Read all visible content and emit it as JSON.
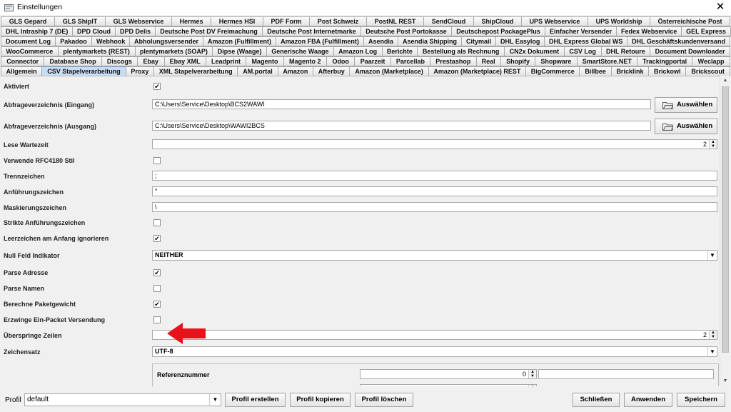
{
  "window": {
    "title": "Einstellungen",
    "close_glyph": "✕"
  },
  "tab_rows": [
    [
      "GLS Gepard",
      "GLS ShipIT",
      "GLS Webservice",
      "Hermes",
      "Hermes HSI",
      "PDF Form",
      "Post Schweiz",
      "PostNL REST",
      "SendCloud",
      "ShipCloud",
      "UPS Webservice",
      "UPS Worldship",
      "Österreichische Post"
    ],
    [
      "DHL Intraship 7 (DE)",
      "DPD Cloud",
      "DPD Delis",
      "Deutsche Post DV Freimachung",
      "Deutsche Post Internetmarke",
      "Deutsche Post Portokasse",
      "Deutschepost PackagePlus",
      "Einfacher Versender",
      "Fedex Webservice",
      "GEL Express"
    ],
    [
      "Document Log",
      "Pakadoo",
      "Webhook",
      "Abholungsversender",
      "Amazon (Fulfillment)",
      "Amazon FBA (Fulfillment)",
      "Asendia",
      "Asendia Shipping",
      "Citymail",
      "DHL Easylog",
      "DHL Express Global WS",
      "DHL Geschäftskundenversand"
    ],
    [
      "WooCommerce",
      "plentymarkets (REST)",
      "plentymarkets (SOAP)",
      "Dipse (Waage)",
      "Generische Waage",
      "Amazon Log",
      "Berichte",
      "Bestellung als Rechnung",
      "CN2x Dokument",
      "CSV Log",
      "DHL Retoure",
      "Document Downloader"
    ],
    [
      "Connector",
      "Database Shop",
      "Discogs",
      "Ebay",
      "Ebay XML",
      "Leadprint",
      "Magento",
      "Magento 2",
      "Odoo",
      "Paarzeit",
      "Parcellab",
      "Prestashop",
      "Real",
      "Shopify",
      "Shopware",
      "SmartStore.NET",
      "Trackingportal",
      "Weclapp"
    ],
    [
      "Allgemein",
      "CSV Stapelverarbeitung",
      "Proxy",
      "XML Stapelverarbeitung",
      "AM.portal",
      "Amazon",
      "Afterbuy",
      "Amazon (Marketplace)",
      "Amazon (Marketplace) REST",
      "BigCommerce",
      "Billbee",
      "Bricklink",
      "Brickowl",
      "Brickscout"
    ]
  ],
  "active_tab": "CSV Stapelverarbeitung",
  "settings": {
    "aktiviert": {
      "label": "Aktiviert",
      "checked": true,
      "mark": "✔"
    },
    "input_dir": {
      "label": "Abfrageverzeichnis (Eingang)",
      "value": "C:\\Users\\Service\\Desktop\\BCS2WAWI",
      "button": "Auswählen"
    },
    "output_dir": {
      "label": "Abfrageverzeichnis (Ausgang)",
      "value": "C:\\Users\\Service\\Desktop\\WAWI2BCS",
      "button": "Auswählen"
    },
    "lese_wartezeit": {
      "label": "Lese Wartezeit",
      "value": "2"
    },
    "rfc4180": {
      "label": "Verwende RFC4180 Stil",
      "checked": false
    },
    "trennzeichen": {
      "label": "Trennzeichen",
      "value": ";"
    },
    "anfuehrungszeichen": {
      "label": "Anführungszeichen",
      "value": "\""
    },
    "maskierungszeichen": {
      "label": "Maskierungszeichen",
      "value": "\\"
    },
    "strikte": {
      "label": "Strikte Anführungszeichen",
      "checked": false
    },
    "leerzeichen": {
      "label": "Leerzeichen am Anfang ignorieren",
      "checked": true,
      "mark": "✔"
    },
    "null_feld": {
      "label": "Null Feld Indikator",
      "value": "NEITHER"
    },
    "parse_adresse": {
      "label": "Parse Adresse",
      "checked": true,
      "mark": "✔"
    },
    "parse_namen": {
      "label": "Parse Namen",
      "checked": false
    },
    "paketgewicht": {
      "label": "Berechne Paketgewicht",
      "checked": true,
      "mark": "✔"
    },
    "ein_packet": {
      "label": "Erzwinge Ein-Packet Versendung",
      "checked": false
    },
    "ueberspringe": {
      "label": "Überspringe Zeilen",
      "value": "2"
    },
    "zeichensatz": {
      "label": "Zeichensatz",
      "value": "UTF-8"
    },
    "referenznummer": {
      "label": "Referenznummer",
      "value": "0"
    }
  },
  "footer": {
    "profile_label": "Profil",
    "profile_value": "default",
    "create": "Profil erstellen",
    "copy": "Profil kopieren",
    "delete": "Profil löschen",
    "close": "Schließen",
    "apply": "Anwenden",
    "save": "Speichern"
  },
  "glyphs": {
    "spin_up": "▲",
    "spin_down": "▼",
    "dropdown": "▼",
    "scroll_up": "▲",
    "scroll_down": "▼"
  },
  "colors": {
    "annotation_arrow": "#e8121a",
    "active_tab": "#c9def5"
  }
}
